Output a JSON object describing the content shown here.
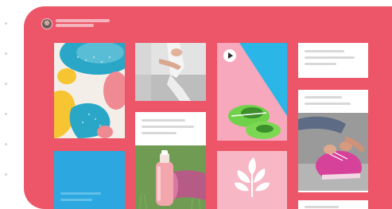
{
  "board": {
    "accent": "#ec5668",
    "header": {
      "avatar": "user-avatar",
      "title_placeholder": "text-placeholder-bar",
      "subtitle_placeholder": "text-placeholder-bar"
    },
    "tiles": [
      {
        "kind": "abstract-pattern-art",
        "colors": [
          "#2aa6c6",
          "#f6c531",
          "#f08a92"
        ]
      },
      {
        "kind": "photo-stretching-legs"
      },
      {
        "kind": "video-thumbnail-sneakers",
        "icon": "play-icon"
      },
      {
        "kind": "text-placeholder-card"
      },
      {
        "kind": "text-placeholder-card"
      },
      {
        "kind": "photo-water-bottle-yoga-mat"
      },
      {
        "kind": "photo-tying-pink-shoes"
      },
      {
        "kind": "solid-blue-card"
      },
      {
        "kind": "leaf-logo-card",
        "icon": "leaf-icon"
      },
      {
        "kind": "text-placeholder-card"
      }
    ]
  }
}
